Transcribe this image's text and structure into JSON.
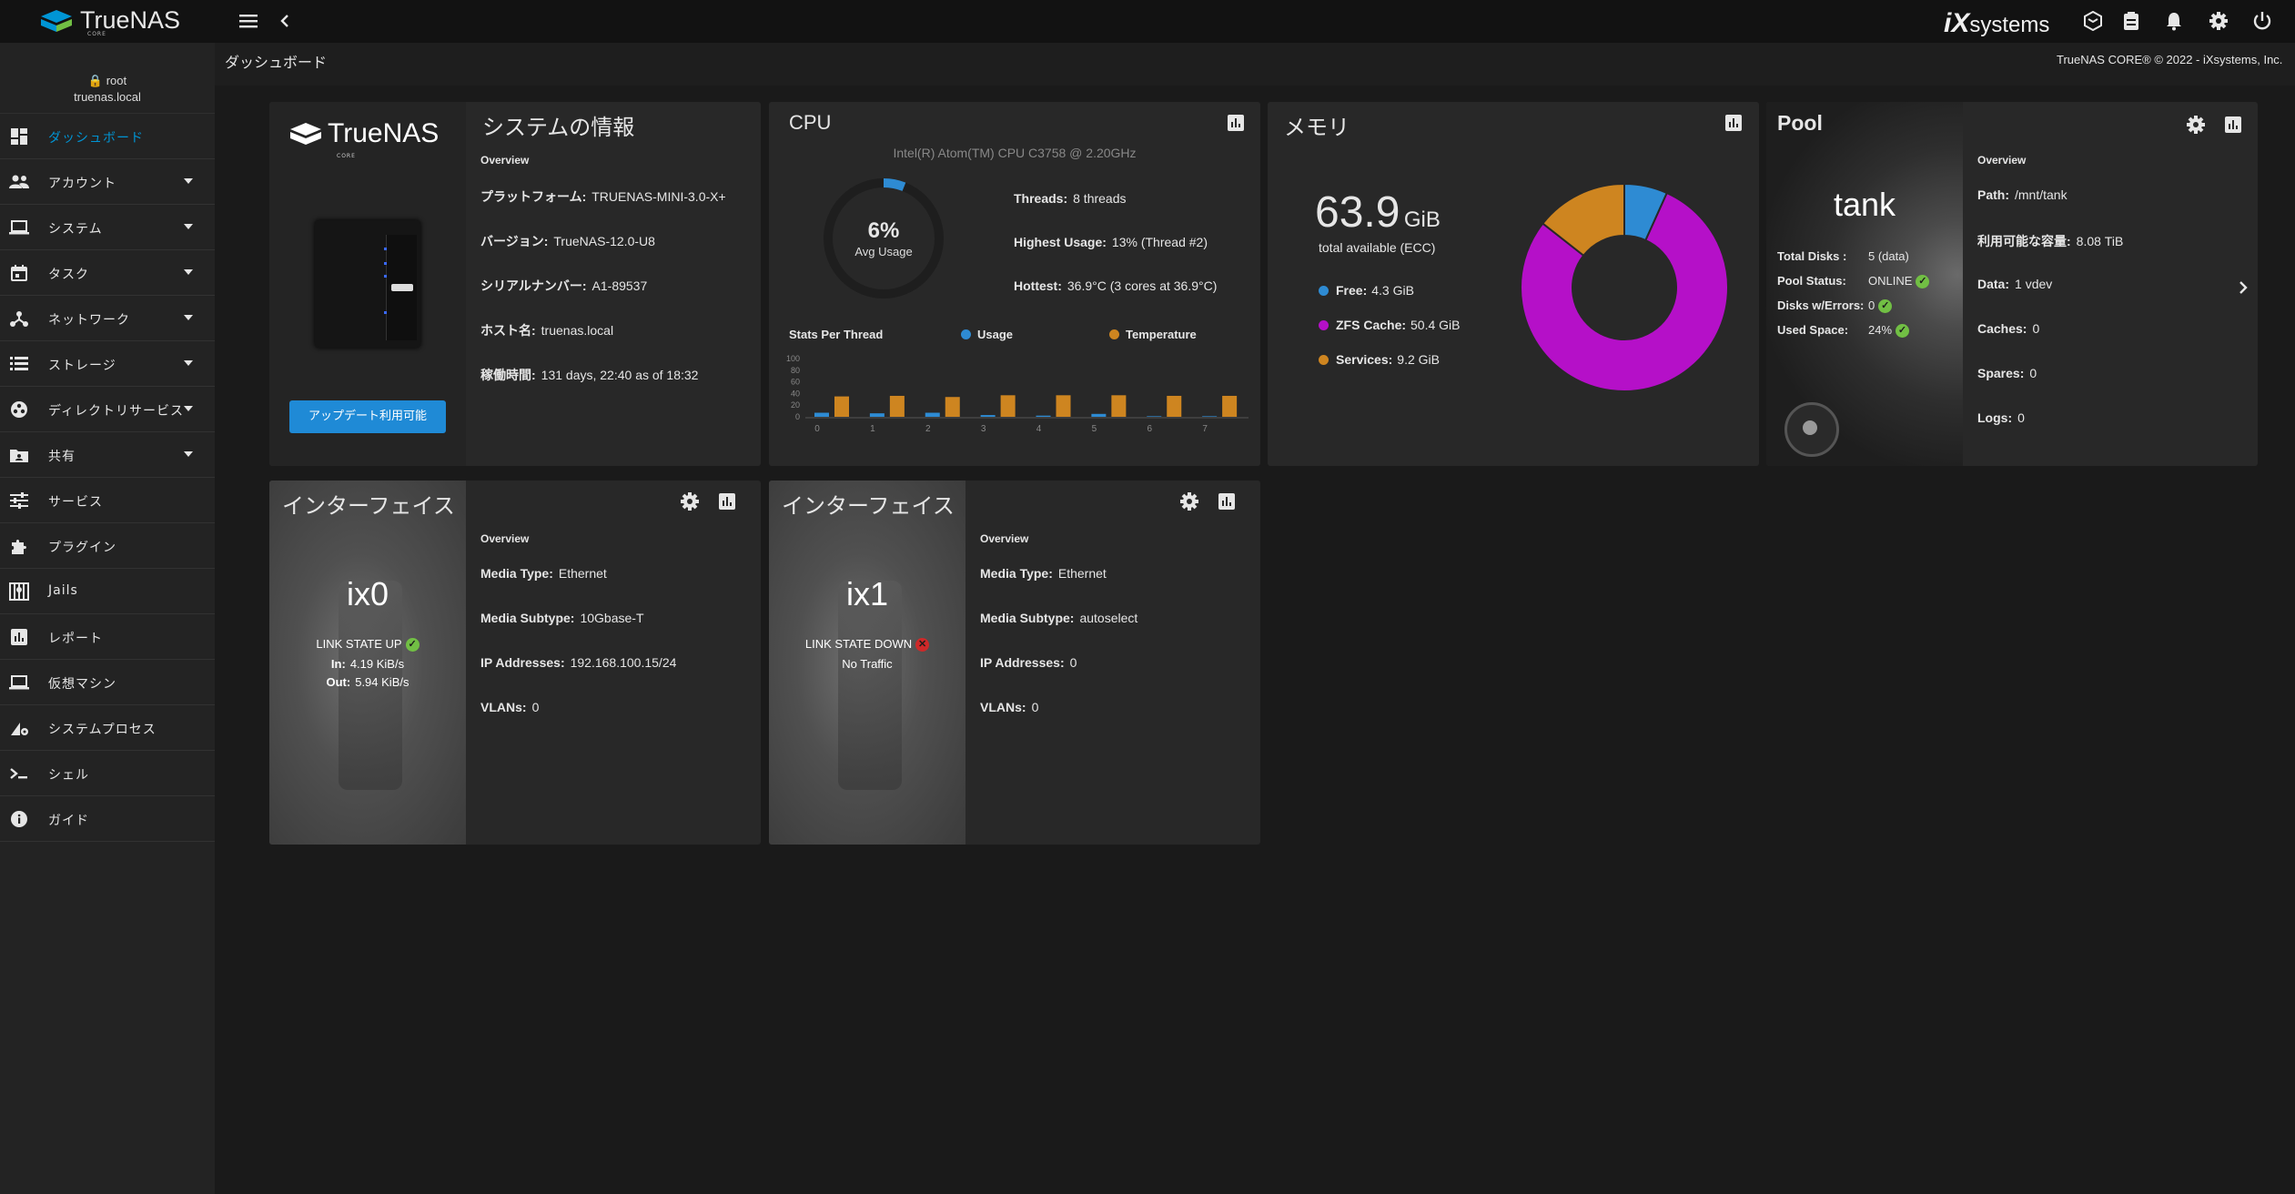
{
  "topbar": {
    "brand": "TrueNAS",
    "brand_sub": "CORE",
    "vendor_logo": "systems",
    "vendor_logo_prefix": "iX",
    "icons": [
      "menu-icon",
      "chevron-left-icon",
      "truecommand-icon",
      "directory-services-icon",
      "bell-icon",
      "gear-icon",
      "power-icon"
    ]
  },
  "sidebar": {
    "user": "root",
    "host": "truenas.local",
    "items": [
      {
        "label": "ダッシュボード",
        "icon": "dashboard-icon",
        "active": true,
        "caret": false
      },
      {
        "label": "アカウント",
        "icon": "people-icon",
        "active": false,
        "caret": true
      },
      {
        "label": "システム",
        "icon": "laptop-icon",
        "active": false,
        "caret": true
      },
      {
        "label": "タスク",
        "icon": "calendar-icon",
        "active": false,
        "caret": true
      },
      {
        "label": "ネットワーク",
        "icon": "network-icon",
        "active": false,
        "caret": true
      },
      {
        "label": "ストレージ",
        "icon": "storage-list-icon",
        "active": false,
        "caret": true
      },
      {
        "label": "ディレクトリサービス",
        "icon": "directory-icon",
        "active": false,
        "caret": true
      },
      {
        "label": "共有",
        "icon": "folder-share-icon",
        "active": false,
        "caret": true
      },
      {
        "label": "サービス",
        "icon": "tune-icon",
        "active": false,
        "caret": false
      },
      {
        "label": "プラグイン",
        "icon": "puzzle-icon",
        "active": false,
        "caret": false
      },
      {
        "label": "Jails",
        "icon": "jail-icon",
        "active": false,
        "caret": false
      },
      {
        "label": "レポート",
        "icon": "chart-icon",
        "active": false,
        "caret": false
      },
      {
        "label": "仮想マシン",
        "icon": "computer-icon",
        "active": false,
        "caret": false
      },
      {
        "label": "システムプロセス",
        "icon": "process-icon",
        "active": false,
        "caret": false
      },
      {
        "label": "シェル",
        "icon": "terminal-icon",
        "active": false,
        "caret": false
      },
      {
        "label": "ガイド",
        "icon": "info-icon",
        "active": false,
        "caret": false
      }
    ]
  },
  "header": {
    "page_title": "ダッシュボード",
    "copyright": "TrueNAS CORE® © 2022 - iXsystems, Inc."
  },
  "sysinfo": {
    "title": "システムの情報",
    "brand": "TrueNAS",
    "brand_sub": "CORE",
    "overview": "Overview",
    "update_button": "アップデート利用可能",
    "rows": [
      {
        "k": "プラットフォーム:",
        "v": "TRUENAS-MINI-3.0-X+"
      },
      {
        "k": "バージョン:",
        "v": "TrueNAS-12.0-U8"
      },
      {
        "k": "シリアルナンバー:",
        "v": "A1-89537"
      },
      {
        "k": "ホスト名:",
        "v": "truenas.local"
      },
      {
        "k": "稼働時間:",
        "v": "131 days, 22:40 as of 18:32"
      }
    ]
  },
  "cpu": {
    "title": "CPU",
    "model": "Intel(R) Atom(TM) CPU C3758 @ 2.20GHz",
    "avg_usage_value": "6%",
    "avg_usage_label": "Avg Usage",
    "avg_usage_fraction": 0.06,
    "rows": [
      {
        "k": "Threads:",
        "v": "8 threads"
      },
      {
        "k": "Highest Usage:",
        "v": "13%  (Thread #2)"
      },
      {
        "k": "Hottest:",
        "v": "36.9°C  (3 cores at 36.9°C)"
      }
    ],
    "chart_title": "Stats Per Thread",
    "legend_usage": "Usage",
    "legend_temp": "Temperature",
    "colors": {
      "usage": "#2e8bd3",
      "temperature": "#ce8520",
      "ring": "#2e8bd3"
    }
  },
  "chart_data": {
    "type": "bar",
    "title": "Stats Per Thread",
    "categories": [
      "0",
      "1",
      "2",
      "3",
      "4",
      "5",
      "6",
      "7"
    ],
    "series": [
      {
        "name": "Usage",
        "values": [
          7,
          6,
          7,
          3,
          2,
          5,
          1,
          1
        ]
      },
      {
        "name": "Temperature",
        "values": [
          35,
          36,
          34,
          37,
          37,
          37,
          36,
          36
        ]
      }
    ],
    "y_ticks": [
      "100",
      "80",
      "60",
      "40",
      "20",
      "0"
    ],
    "ylim": [
      0,
      100
    ]
  },
  "memory": {
    "title": "メモリ",
    "total_value": "63.9",
    "total_unit": "GiB",
    "total_label": "total available (ECC)",
    "legend": [
      {
        "label": "Free:",
        "value": "4.3 GiB",
        "color": "#2e8bd3",
        "amount": 4.3
      },
      {
        "label": "ZFS Cache:",
        "value": "50.4 GiB",
        "color": "#b510c8",
        "amount": 50.4
      },
      {
        "label": "Services:",
        "value": "9.2 GiB",
        "color": "#ce8520",
        "amount": 9.2
      }
    ]
  },
  "pool": {
    "title": "Pool",
    "name": "tank",
    "overview": "Overview",
    "left_rows": [
      {
        "k": "Total Disks :",
        "v": "5 (data)"
      },
      {
        "k": "Pool Status:",
        "v": "ONLINE",
        "ok": true
      },
      {
        "k": "Disks w/Errors:",
        "v": "0",
        "ok": true
      },
      {
        "k": "Used Space:",
        "v": "24%",
        "ok": true
      }
    ],
    "right_rows": [
      {
        "k": "Path:",
        "v": "/mnt/tank"
      },
      {
        "k": "利用可能な容量:",
        "v": "8.08 TiB"
      },
      {
        "k": "Data:",
        "v": "1 vdev"
      },
      {
        "k": "Caches:",
        "v": "0"
      },
      {
        "k": "Spares:",
        "v": "0"
      },
      {
        "k": "Logs:",
        "v": "0"
      }
    ]
  },
  "interfaces": [
    {
      "title": "インターフェイス",
      "name": "ix0",
      "link_state": "LINK STATE UP",
      "link_up": true,
      "traffic_in_label": "In:",
      "traffic_in": "4.19 KiB/s",
      "traffic_out_label": "Out:",
      "traffic_out": "5.94 KiB/s",
      "overview": "Overview",
      "rows": [
        {
          "k": "Media Type:",
          "v": "Ethernet"
        },
        {
          "k": "Media Subtype:",
          "v": "10Gbase-T"
        },
        {
          "k": "IP Addresses:",
          "v": "192.168.100.15/24"
        },
        {
          "k": "VLANs:",
          "v": "0"
        }
      ]
    },
    {
      "title": "インターフェイス",
      "name": "ix1",
      "link_state": "LINK STATE DOWN",
      "link_up": false,
      "no_traffic": "No Traffic",
      "overview": "Overview",
      "rows": [
        {
          "k": "Media Type:",
          "v": "Ethernet"
        },
        {
          "k": "Media Subtype:",
          "v": "autoselect"
        },
        {
          "k": "IP Addresses:",
          "v": "0"
        },
        {
          "k": "VLANs:",
          "v": "0"
        }
      ]
    }
  ]
}
